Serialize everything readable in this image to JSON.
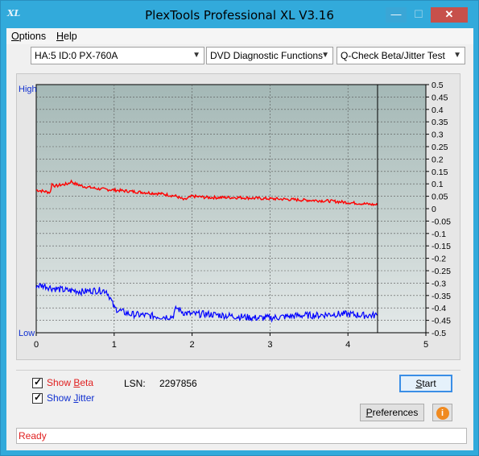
{
  "window": {
    "title": "PlexTools Professional XL V3.16",
    "icon_text": "XL",
    "controls": {
      "minimize": "—",
      "maximize": "☐",
      "close": "✕"
    }
  },
  "menu": {
    "options": {
      "label": "ptions",
      "mnemonic": "O"
    },
    "help": {
      "label": "elp",
      "mnemonic": "H"
    }
  },
  "toolbar": {
    "drive_select": "HA:5 ID:0  PX-760A",
    "function_select": "DVD Diagnostic Functions",
    "test_select": "Q-Check Beta/Jitter Test"
  },
  "chart_data": {
    "type": "line",
    "left_axis_labels": {
      "high": "High",
      "low": "Low"
    },
    "x": {
      "ticks": [
        0,
        1,
        2,
        3,
        4,
        5
      ],
      "lim": [
        0,
        5
      ],
      "cursor": 4.38
    },
    "y_right": {
      "ticks": [
        "0.5",
        "0.45",
        "0.4",
        "0.35",
        "0.3",
        "0.25",
        "0.2",
        "0.15",
        "0.1",
        "0.05",
        "0",
        "-0.05",
        "-0.1",
        "-0.15",
        "-0.2",
        "-0.25",
        "-0.3",
        "-0.35",
        "-0.4",
        "-0.45",
        "-0.5"
      ],
      "lim": [
        -0.5,
        0.5
      ]
    },
    "grid": true,
    "series": [
      {
        "name": "Beta",
        "color": "#ff0000",
        "x": [
          0.0,
          0.1,
          0.18,
          0.2,
          0.25,
          0.3,
          0.4,
          0.45,
          0.5,
          0.6,
          0.8,
          1.0,
          1.2,
          1.4,
          1.6,
          1.8,
          1.9,
          2.0,
          2.2,
          2.4,
          2.6,
          2.8,
          3.0,
          3.2,
          3.4,
          3.6,
          3.8,
          4.0,
          4.2,
          4.38
        ],
        "values": [
          0.075,
          0.07,
          0.065,
          0.1,
          0.09,
          0.095,
          0.1,
          0.11,
          0.1,
          0.09,
          0.08,
          0.075,
          0.07,
          0.065,
          0.06,
          0.05,
          0.035,
          0.05,
          0.045,
          0.045,
          0.045,
          0.042,
          0.04,
          0.038,
          0.035,
          0.033,
          0.03,
          0.025,
          0.02,
          0.015
        ]
      },
      {
        "name": "Jitter",
        "color": "#0000ff",
        "x": [
          0.0,
          0.1,
          0.2,
          0.3,
          0.4,
          0.5,
          0.6,
          0.7,
          0.8,
          0.9,
          0.95,
          1.0,
          1.1,
          1.2,
          1.4,
          1.6,
          1.75,
          1.8,
          1.9,
          2.0,
          2.2,
          2.4,
          2.6,
          2.8,
          3.0,
          3.2,
          3.4,
          3.6,
          3.8,
          4.0,
          4.2,
          4.38
        ],
        "values": [
          -0.31,
          -0.31,
          -0.32,
          -0.325,
          -0.33,
          -0.33,
          -0.335,
          -0.33,
          -0.33,
          -0.33,
          -0.36,
          -0.4,
          -0.415,
          -0.425,
          -0.43,
          -0.435,
          -0.435,
          -0.4,
          -0.42,
          -0.425,
          -0.425,
          -0.43,
          -0.435,
          -0.44,
          -0.44,
          -0.435,
          -0.43,
          -0.43,
          -0.425,
          -0.425,
          -0.43,
          -0.43
        ]
      }
    ]
  },
  "controls": {
    "show_beta": {
      "label_pre": "Show ",
      "label_mn": "B",
      "label_post": "eta",
      "checked": true
    },
    "show_jitter": {
      "label_pre": "Show ",
      "label_mn": "J",
      "label_post": "itter",
      "checked": true
    },
    "lsn_label": "LSN:",
    "lsn_value": "2297856",
    "start_button": {
      "mn": "S",
      "rest": "tart"
    },
    "preferences_button": {
      "mn": "P",
      "rest": "references"
    },
    "info_button": "i"
  },
  "status": {
    "text": "Ready"
  }
}
